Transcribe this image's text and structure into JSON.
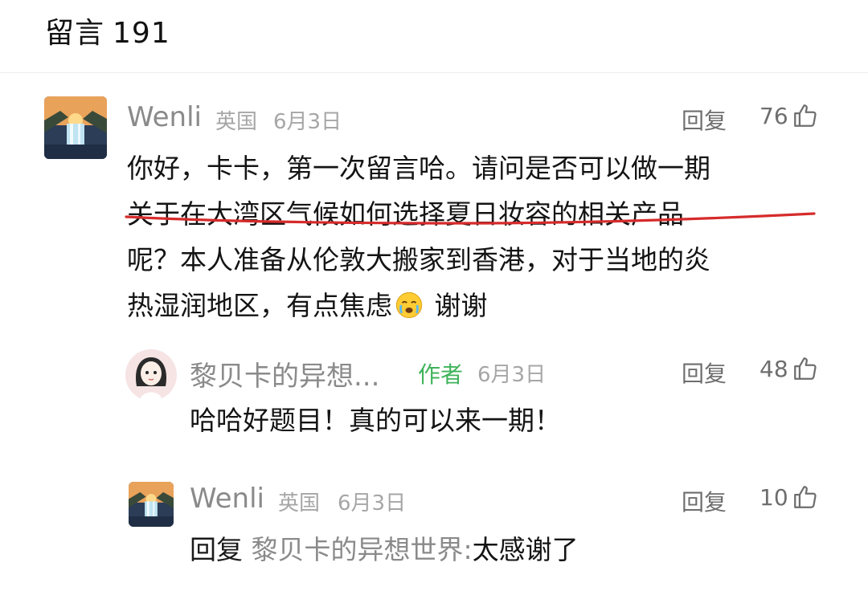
{
  "header": {
    "title": "留言",
    "count": "191"
  },
  "comments": [
    {
      "author": "Wenli",
      "location": "英国",
      "date": "6月3日",
      "reply_label": "回复",
      "likes": "76",
      "lines": [
        "你好，卡卡，第一次留言哈。请问是否可以做一期",
        "关于在大湾区气候如何选择夏日妆容的相关产品",
        "呢？本人准备从伦敦大搬家到香港，对于当地的炎",
        "热湿润地区，有点焦虑"
      ],
      "line4_suffix": " 谢谢",
      "emoji_icon": "crying-face-icon"
    },
    {
      "author": "黎贝卡的异想...",
      "badge": "作者",
      "date": "6月3日",
      "reply_label": "回复",
      "likes": "48",
      "text": "哈哈好题目！真的可以来一期！"
    },
    {
      "author": "Wenli",
      "location": "英国",
      "date": "6月3日",
      "reply_label": "回复",
      "likes": "10",
      "reply_prefix": "回复",
      "reply_target": "黎贝卡的异想世界:",
      "text": "太感谢了"
    }
  ],
  "colors": {
    "underline": "#d62b2b",
    "author_badge": "#3fb35a",
    "meta": "#a6a6a6"
  }
}
